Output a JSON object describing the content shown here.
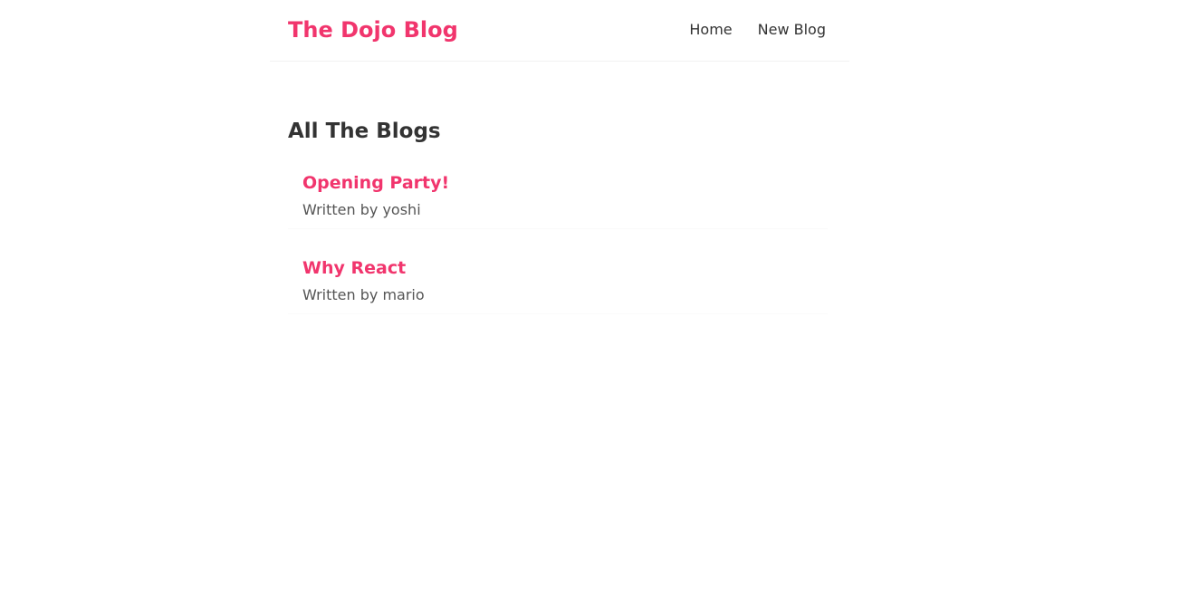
{
  "header": {
    "brand": "The Dojo Blog",
    "links": [
      {
        "label": "Home"
      },
      {
        "label": "New Blog"
      }
    ]
  },
  "main": {
    "title": "All The Blogs",
    "blogs": [
      {
        "title": "Opening Party!",
        "author": "Written by yoshi"
      },
      {
        "title": "Why React",
        "author": "Written by mario"
      }
    ]
  },
  "colors": {
    "accent": "#f1356d",
    "text": "#333333"
  }
}
